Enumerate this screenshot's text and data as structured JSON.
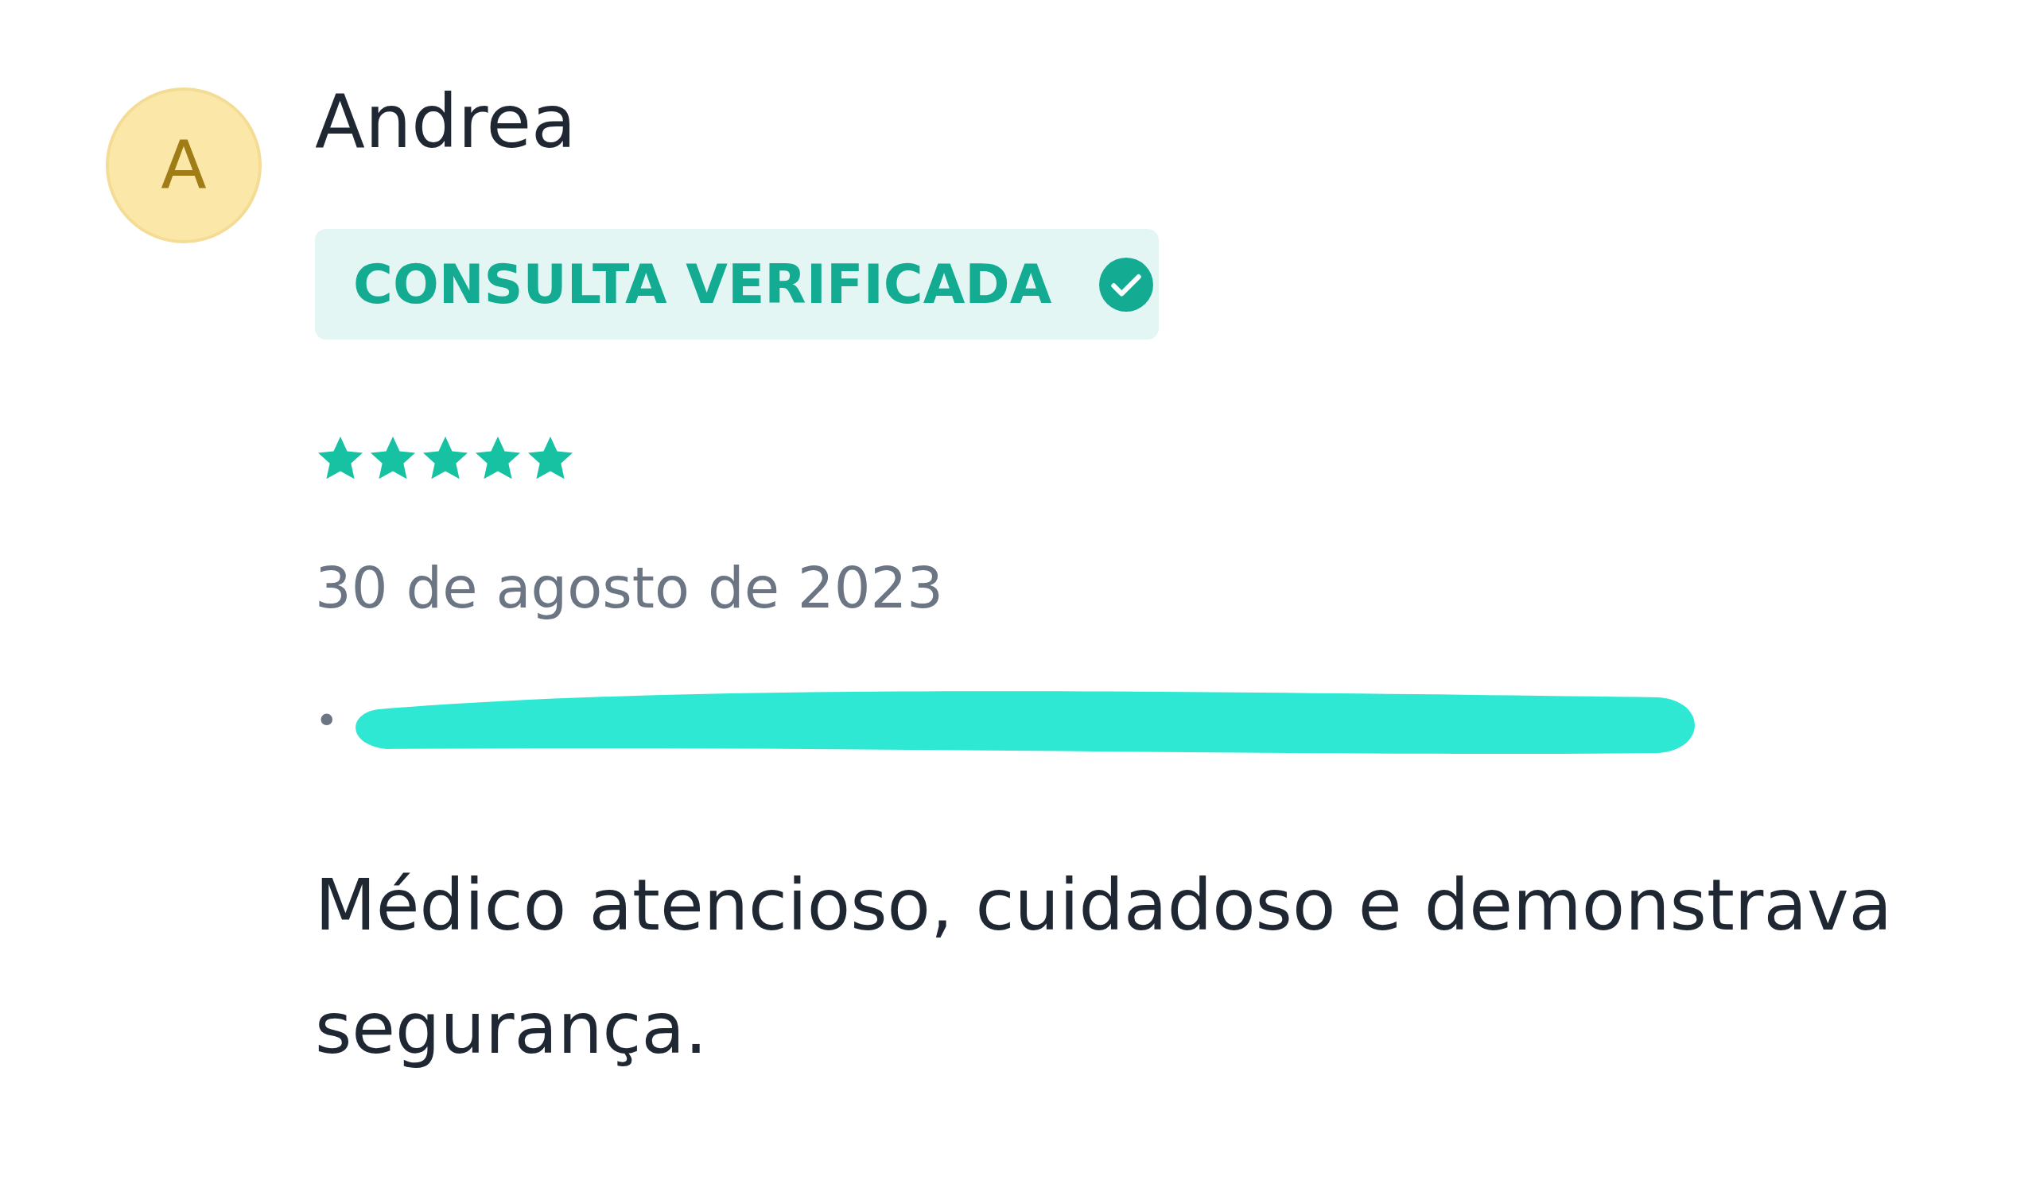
{
  "review": {
    "avatar": {
      "initial": "A"
    },
    "reviewer": "Andrea",
    "badge": {
      "label": "CONSULTA VERIFICADA",
      "verified": true
    },
    "stars": 5,
    "date": "30 de agosto de 2023",
    "detail": {
      "bullet": "•",
      "redacted": true
    },
    "text": "Médico atencioso, cuidadoso e demonstrava segurança."
  }
}
